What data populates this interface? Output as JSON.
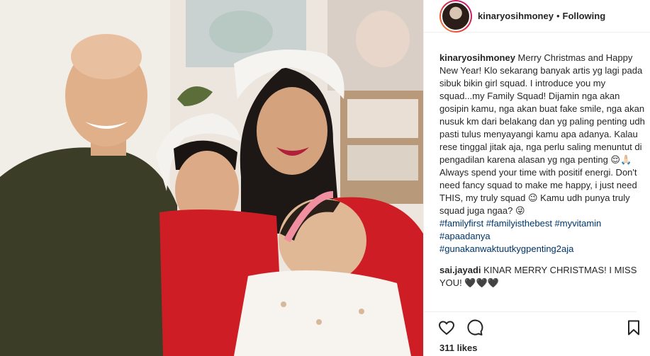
{
  "post": {
    "username": "kinaryosihmoney",
    "separator": "•",
    "follow_status": "Following",
    "caption_text": " Merry Christmas and Happy New Year! Klo sekarang banyak artis yg lagi pada sibuk bikin girl squad. I introduce you my squad...my Family Squad! Dijamin nga akan gosipin kamu, nga akan buat fake smile, nga akan nusuk km dari belakang dan yg paling penting udh pasti tulus menyayangi kamu apa adanya. Kalau rese tinggal jitak aja, nga perlu saling menuntut di pengadilan karena alasan yg nga penting 😌🙏🏻 Always spend your time with positif energi. Don't need fancy squad to make me happy, i just need THIS, my truly squad 😉 Kamu udh punya truly squad juga ngaa? 😜",
    "hashtags": [
      "#familyfirst #familyisthebest #myvitamin",
      "#apaadanya",
      "#gunakanwaktuutkygpenting2aja"
    ],
    "comment": {
      "username": "sai.jayadi",
      "text": " KINAR MERRY CHRISTMAS! I MISS YOU! 🖤🖤🖤"
    },
    "likes": "311 likes"
  },
  "icons": {
    "like": "heart-icon",
    "comment": "comment-icon",
    "save": "bookmark-icon"
  },
  "colors": {
    "accent_link": "#003569",
    "text": "#262626",
    "border": "#efefef"
  }
}
